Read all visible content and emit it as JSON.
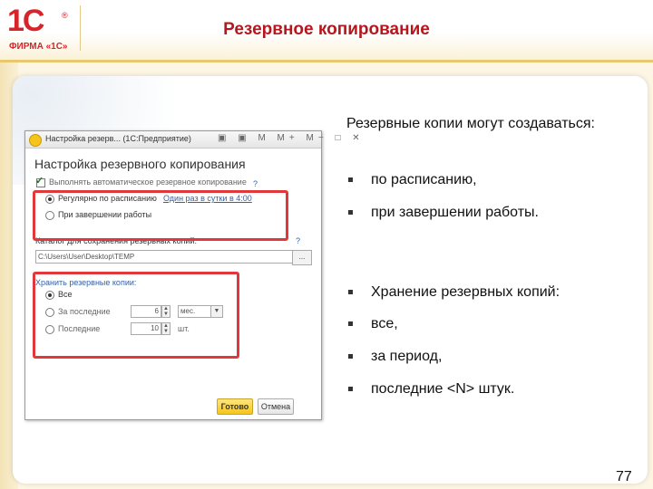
{
  "header": {
    "logo_text": "1С",
    "logo_reg": "®",
    "logo_firma": "ФИРМА «1С»",
    "title": "Резервное копирование"
  },
  "window": {
    "title": "Настройка резерв... (1С:Предприятие)",
    "toolbar_icons": "▣ ▣ M M+ M− □ ✕",
    "heading": "Настройка резервного копирования",
    "auto_backup_label": "Выполнять автоматическое резервное копирование",
    "help_mark": "?",
    "schedule_label": "Регулярно по расписанию",
    "schedule_link": "Один раз в сутки в 4:00",
    "on_exit_label": "При завершении работы",
    "catalog_label": "Каталог для сохранения резервных копий:",
    "catalog_value": "C:\\Users\\User\\Desktop\\ТЕМР",
    "browse_label": "...",
    "keep_label": "Хранить резервные копии:",
    "keep_all": "Все",
    "keep_period": "За последние",
    "keep_period_value": "6",
    "keep_period_unit": "мес.",
    "keep_last": "Последние",
    "keep_last_value": "10",
    "keep_last_unit": "шт.",
    "ok_label": "Готово",
    "cancel_label": "Отмена"
  },
  "content": {
    "intro": "Резервные копии могут создаваться:",
    "bullets": [
      "по расписанию,",
      "при завершении работы.",
      "Хранение резервных копий:",
      "все,",
      "за период,",
      "последние <N> штук."
    ]
  },
  "page_number": "77",
  "colors": {
    "brand_red": "#d8232a",
    "title_red": "#b5171e",
    "highlight_red": "#e0383b",
    "ok_yellow": "#f5c518"
  }
}
